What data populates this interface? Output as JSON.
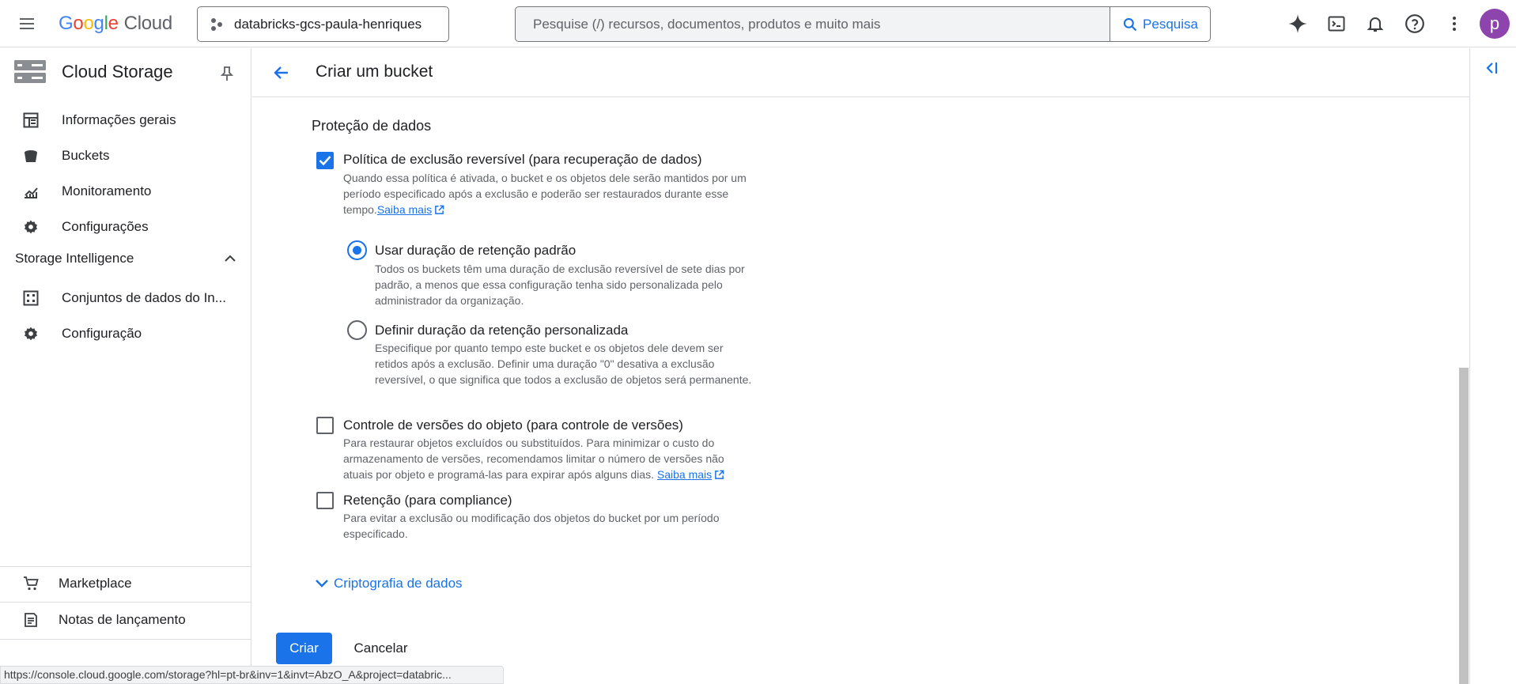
{
  "header": {
    "logo_text": {
      "g1": "G",
      "g2": "o",
      "g3": "o",
      "g4": "g",
      "g5": "l",
      "g6": "e",
      "cloud": "Cloud"
    },
    "project": "databricks-gcs-paula-henriques",
    "search_placeholder": "Pesquise (/) recursos, documentos, produtos e muito mais",
    "search_button": "Pesquisa",
    "avatar_letter": "p"
  },
  "sidebar": {
    "title": "Cloud Storage",
    "items": [
      {
        "label": "Informações gerais",
        "icon": "dashboard-icon"
      },
      {
        "label": "Buckets",
        "icon": "bucket-icon"
      },
      {
        "label": "Monitoramento",
        "icon": "monitoring-icon"
      },
      {
        "label": "Configurações",
        "icon": "gear-icon"
      }
    ],
    "section": "Storage Intelligence",
    "section_items": [
      {
        "label": "Conjuntos de dados do In...",
        "icon": "dataset-icon"
      },
      {
        "label": "Configuração",
        "icon": "gear-icon"
      }
    ],
    "footer_items": [
      {
        "label": "Marketplace",
        "icon": "cart-icon"
      },
      {
        "label": "Notas de lançamento",
        "icon": "notes-icon"
      }
    ]
  },
  "page": {
    "title": "Criar um bucket",
    "section_title": "Proteção de dados",
    "soft_delete": {
      "label": "Política de exclusão reversível (para recuperação de dados)",
      "checked": true,
      "desc1": "Quando essa política é ativada, o bucket e os objetos dele serão mantidos por um",
      "desc2": "período especificado após a exclusão e poderão ser restaurados durante esse",
      "desc3": "tempo.",
      "link": "Saiba mais"
    },
    "retention_default": {
      "label": "Usar duração de retenção padrão",
      "selected": true,
      "desc1": "Todos os buckets têm uma duração de exclusão reversível de sete dias por",
      "desc2": "padrão, a menos que essa configuração tenha sido personalizada pelo",
      "desc3": "administrador da organização."
    },
    "retention_custom": {
      "label": "Definir duração da retenção personalizada",
      "selected": false,
      "desc1": "Especifique por quanto tempo este bucket e os objetos dele devem ser",
      "desc2": "retidos após a exclusão. Definir uma duração \"0\" desativa a exclusão",
      "desc3": "reversível, o que significa que todos a exclusão de objetos será permanente."
    },
    "versioning": {
      "label": "Controle de versões do objeto (para controle de versões)",
      "checked": false,
      "desc1": "Para restaurar objetos excluídos ou substituídos. Para minimizar o custo do",
      "desc2": "armazenamento de versões, recomendamos limitar o número de versões não",
      "desc3": "atuais por objeto e programá-las para expirar após alguns dias.",
      "link": "Saiba mais"
    },
    "retention_compliance": {
      "label": "Retenção (para compliance)",
      "checked": false,
      "desc1": "Para evitar a exclusão ou modificação dos objetos do bucket por um período",
      "desc2": "especificado."
    },
    "encryption_toggle": "Criptografia de dados",
    "create_button": "Criar",
    "cancel_button": "Cancelar"
  },
  "status_url": "https://console.cloud.google.com/storage?hl=pt-br&inv=1&invt=AbzO_A&project=databric...",
  "colors": {
    "accent": "#1a73e8",
    "avatar": "#8e44ad"
  }
}
